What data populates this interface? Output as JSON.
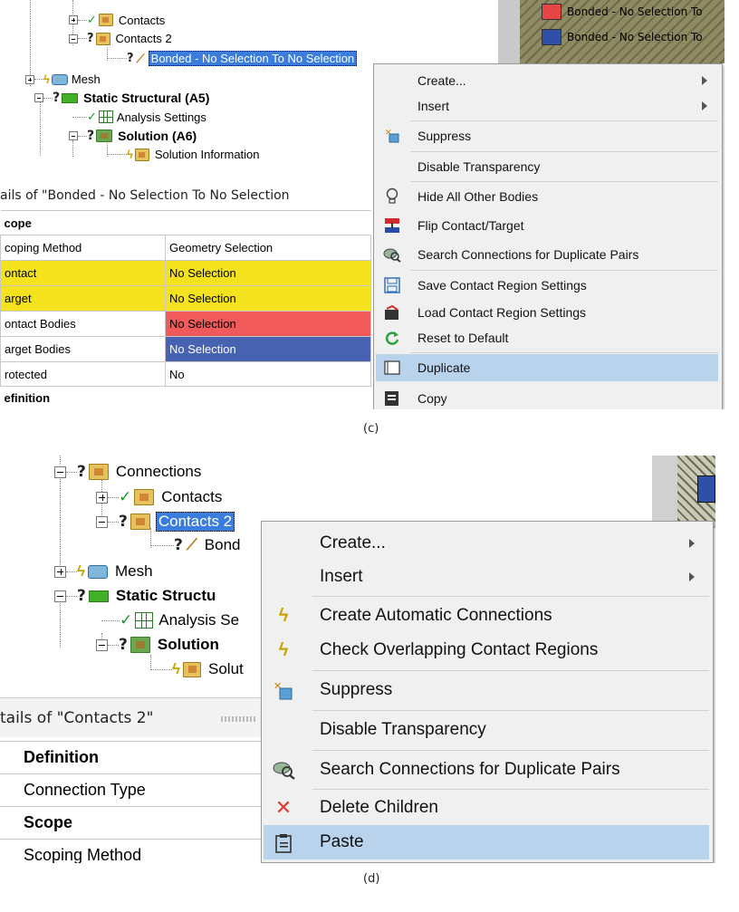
{
  "panel_c": {
    "caption": "(c)",
    "tree": {
      "contacts": "Contacts",
      "contacts2": "Contacts 2",
      "bonded": "Bonded - No Selection To No Selection",
      "mesh": "Mesh",
      "static_structural": "Static Structural (A5)",
      "analysis_settings": "Analysis Settings",
      "solution": "Solution (A6)",
      "solution_info": "Solution Information"
    },
    "details_title": "ails of \"Bonded - No Selection To No Selection",
    "details_rows": [
      {
        "label": "cope",
        "value": "",
        "kind": "section"
      },
      {
        "label": "coping Method",
        "value": "Geometry Selection",
        "kind": "plain"
      },
      {
        "label": "ontact",
        "value": "No Selection",
        "kind": "yellow"
      },
      {
        "label": "arget",
        "value": "No Selection",
        "kind": "yellow"
      },
      {
        "label": "ontact Bodies",
        "value": "No Selection",
        "kind": "red"
      },
      {
        "label": "arget Bodies",
        "value": "No Selection",
        "kind": "blue"
      },
      {
        "label": "rotected",
        "value": "No",
        "kind": "plain"
      },
      {
        "label": "efinition",
        "value": "",
        "kind": "section"
      }
    ],
    "legend": [
      {
        "label": "Bonded - No Selection To",
        "color": "#e64545"
      },
      {
        "label": "Bonded - No Selection To",
        "color": "#2f4fa8"
      }
    ],
    "menu": {
      "create": "Create...",
      "insert": "Insert",
      "suppress": "Suppress",
      "disable_transparency": "Disable Transparency",
      "hide_all_other_bodies": "Hide All Other Bodies",
      "flip_contact_target": "Flip Contact/Target",
      "search_connections": "Search Connections for Duplicate Pairs",
      "save_contact_region": "Save Contact Region Settings",
      "load_contact_region": "Load Contact Region Settings",
      "reset_to_default": "Reset to Default",
      "duplicate": "Duplicate",
      "copy": "Copy"
    }
  },
  "panel_d": {
    "caption": "(d)",
    "tree": {
      "connections": "Connections",
      "contacts": "Contacts",
      "contacts2": "Contacts 2",
      "bonded": "Bond",
      "mesh": "Mesh",
      "static_structural": "Static Structu",
      "analysis_settings": "Analysis Se",
      "solution": "Solution",
      "solution_info": "Solut"
    },
    "details_title": "tails of \"Contacts 2\"",
    "details_rows": [
      {
        "label": "Definition",
        "kind": "section"
      },
      {
        "label": "Connection Type",
        "kind": "plain"
      },
      {
        "label": "Scope",
        "kind": "section"
      },
      {
        "label": "Scoping Method",
        "kind": "plain"
      }
    ],
    "menu": {
      "create": "Create...",
      "insert": "Insert",
      "create_auto": "Create Automatic Connections",
      "check_overlap": "Check Overlapping Contact Regions",
      "suppress": "Suppress",
      "disable_transparency": "Disable Transparency",
      "search_connections": "Search Connections for Duplicate Pairs",
      "delete_children": "Delete Children",
      "paste": "Paste"
    }
  },
  "colors": {
    "highlight": "#b9d3ec",
    "selection": "#3b7ddd",
    "yellow": "#f4e21f",
    "red": "#f05a5a",
    "blue": "#4662b0"
  }
}
